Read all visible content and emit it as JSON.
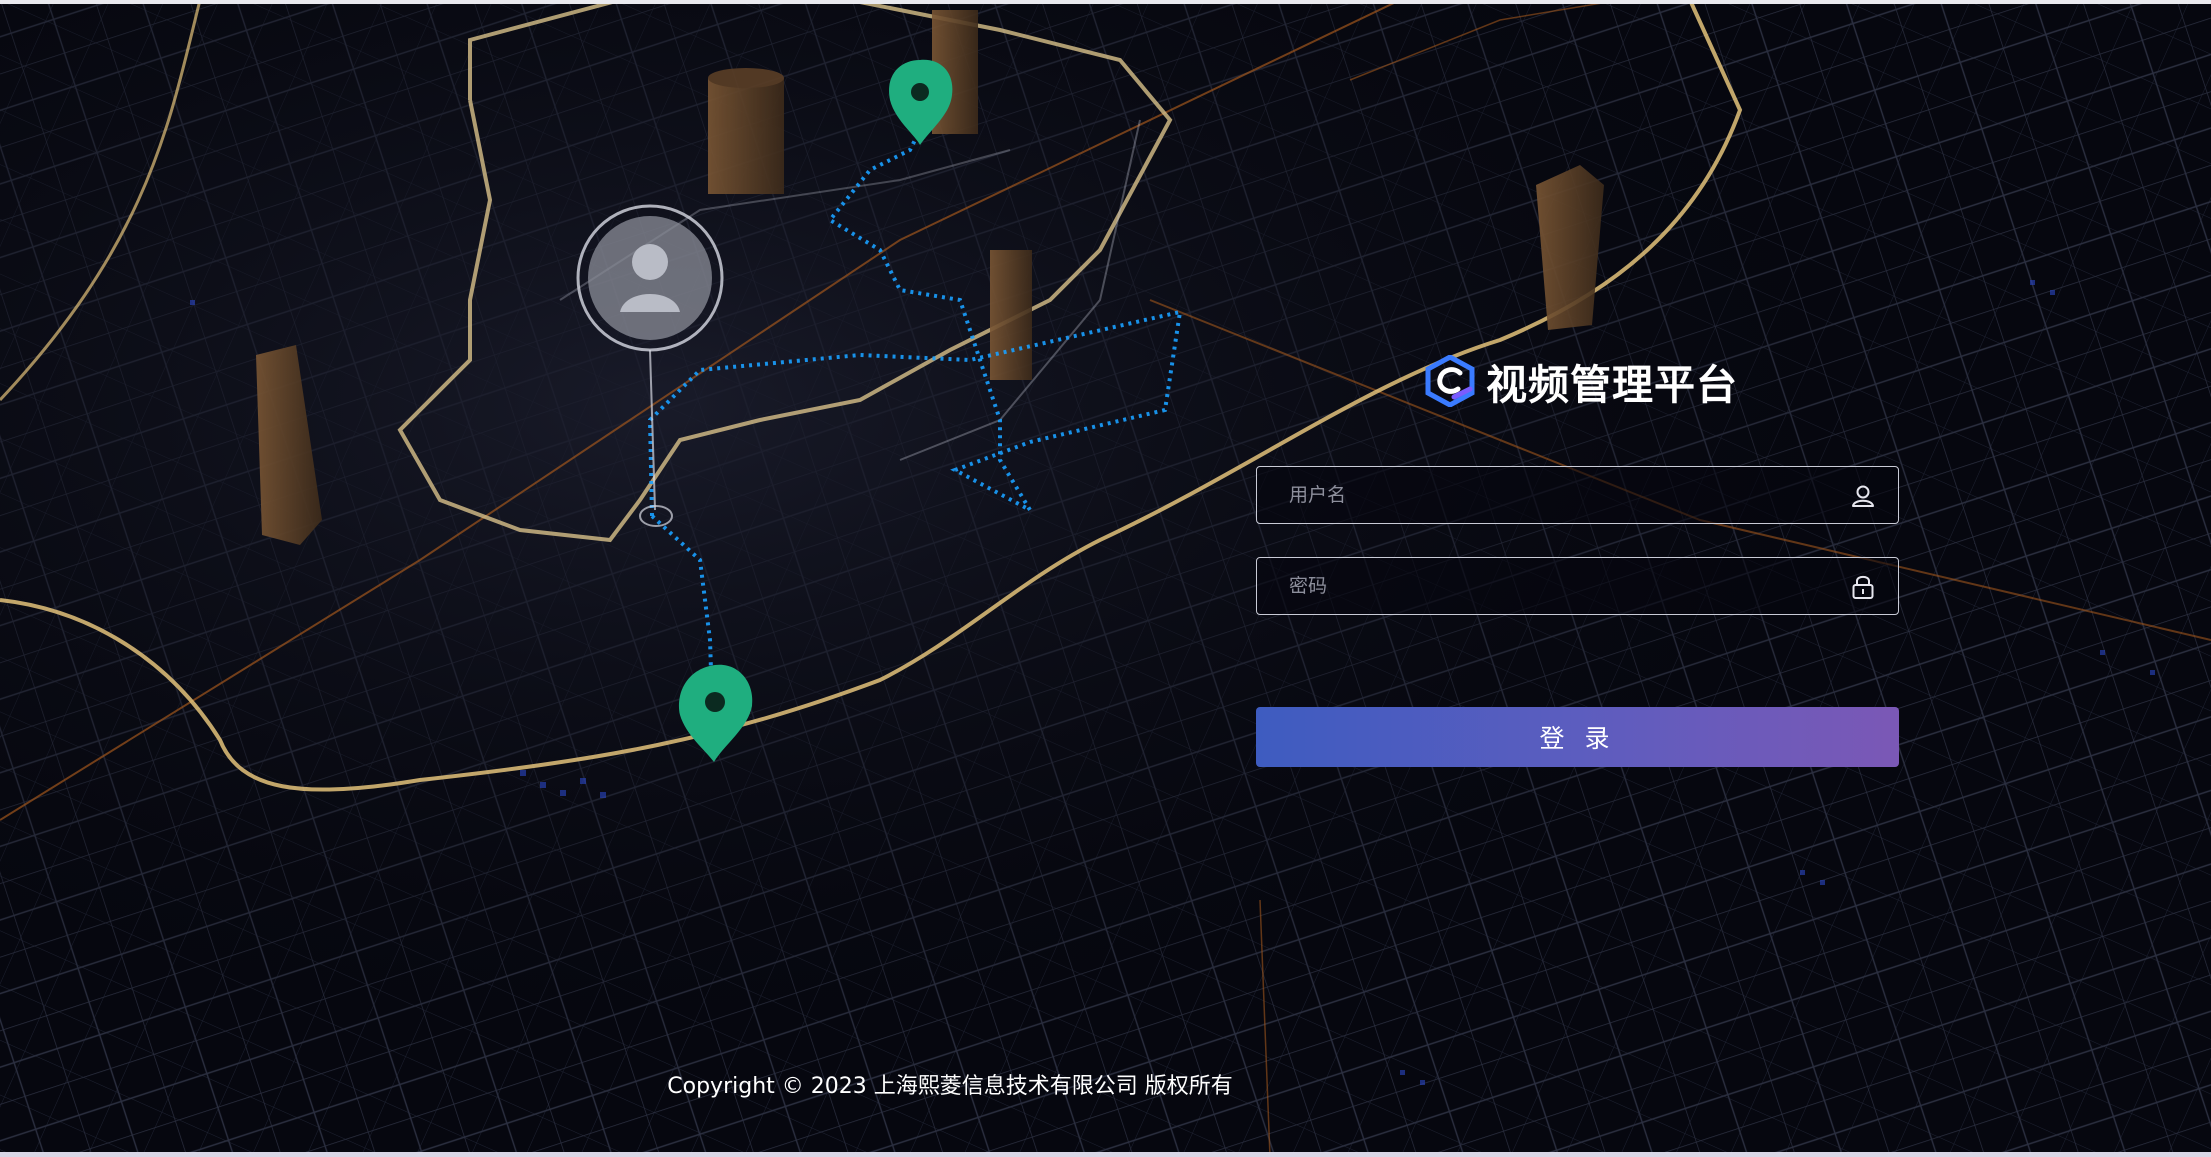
{
  "brand": {
    "title": "视频管理平台",
    "logo_icon": "c-hexagon-logo-icon"
  },
  "form": {
    "username": {
      "placeholder": "用户名",
      "value": "",
      "icon": "user-icon"
    },
    "password": {
      "placeholder": "密码",
      "value": "",
      "icon": "lock-icon"
    },
    "login_label": "登 录"
  },
  "footer": {
    "copyright": "Copyright © 2023 上海熙菱信息技术有限公司 版权所有"
  },
  "colors": {
    "background": "#06070f",
    "route": "#1aa0ff",
    "ring_road": "#e3c27a",
    "pin": "#1fae7f",
    "button_start": "#3e5cc0",
    "button_end": "#7b58b6"
  }
}
